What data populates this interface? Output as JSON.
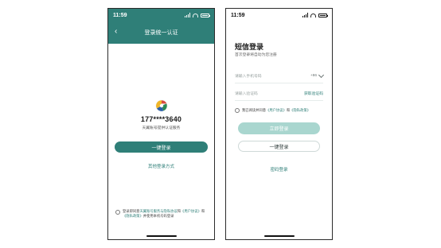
{
  "colors": {
    "accent": "#2f7f78",
    "accent_light": "#a9d6cf",
    "border": "#2b2b2b"
  },
  "left": {
    "status": {
      "time": "11:59"
    },
    "header": {
      "back_icon": "‹",
      "title": "登录统一认证"
    },
    "logo_icon": "operator-logo-icon",
    "phone_masked": "177****3640",
    "service_text": "天翼账号提供认证服务",
    "one_click_login": "一键登录",
    "other_methods": "其他登录方式",
    "agreement": {
      "text_1": "登录即同意",
      "link_1": "天翼账号服务与隐私协议",
      "text_2": "和",
      "link_2": "《用户协议》",
      "text_3": "和",
      "link_3": "《隐私政策》",
      "text_4": "并使用本机号码登录"
    }
  },
  "right": {
    "status": {
      "time": "11:59"
    },
    "title": "短信登录",
    "subtitle": "首次登录将自动为您注册",
    "phone_placeholder": "请输入手机号码",
    "country_code": "+86",
    "code_placeholder": "请输入验证码",
    "get_code": "获取验证码",
    "agreement": {
      "text_1": "我已阅读并同意",
      "link_1": "《用户协议》",
      "text_2": "和",
      "link_2": "《隐私政策》"
    },
    "login_button": "立即登录",
    "one_click_login": "一键登录",
    "password_login": "密码登录"
  }
}
